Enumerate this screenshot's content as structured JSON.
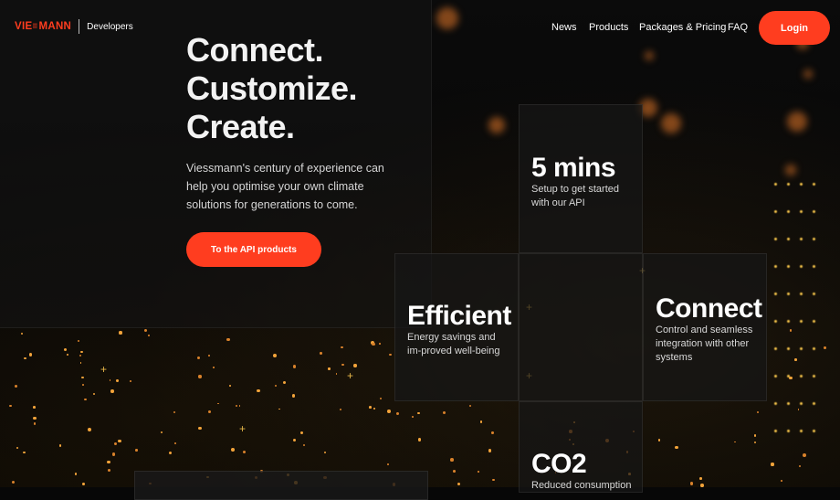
{
  "header": {
    "logo_text": "VIESMANN",
    "logo_sub": "Developers",
    "nav": [
      {
        "label": "News"
      },
      {
        "label": "Products"
      },
      {
        "label": "Packages & Pricing"
      },
      {
        "label": "FAQ"
      }
    ],
    "login_label": "Login"
  },
  "hero": {
    "headline": [
      "Connect.",
      "Customize.",
      "Create."
    ],
    "intro": "Viessmann's century of experience can help you optimise your own climate solutions for generations to come.",
    "cta_label": "To the API products"
  },
  "tiles": [
    {
      "title": "5 mins",
      "text": "Setup to get started with our API"
    },
    {
      "title": "Efficient",
      "text": "Energy savings and im-proved well-being"
    },
    {
      "title": "Connect",
      "text": "Control and seamless integration with other systems"
    },
    {
      "title": "CO2",
      "text": "Reduced consumption"
    }
  ],
  "colors": {
    "accent": "#ff3d1f",
    "background": "#070707"
  }
}
